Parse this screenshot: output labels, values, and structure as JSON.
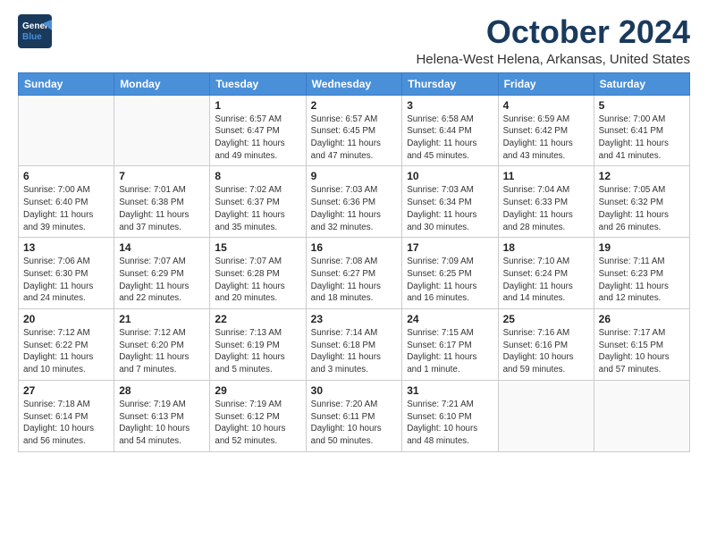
{
  "header": {
    "logo_line1": "General",
    "logo_line2": "Blue",
    "month": "October 2024",
    "location": "Helena-West Helena, Arkansas, United States"
  },
  "weekdays": [
    "Sunday",
    "Monday",
    "Tuesday",
    "Wednesday",
    "Thursday",
    "Friday",
    "Saturday"
  ],
  "weeks": [
    [
      {
        "day": "",
        "info": ""
      },
      {
        "day": "",
        "info": ""
      },
      {
        "day": "1",
        "info": "Sunrise: 6:57 AM\nSunset: 6:47 PM\nDaylight: 11 hours and 49 minutes."
      },
      {
        "day": "2",
        "info": "Sunrise: 6:57 AM\nSunset: 6:45 PM\nDaylight: 11 hours and 47 minutes."
      },
      {
        "day": "3",
        "info": "Sunrise: 6:58 AM\nSunset: 6:44 PM\nDaylight: 11 hours and 45 minutes."
      },
      {
        "day": "4",
        "info": "Sunrise: 6:59 AM\nSunset: 6:42 PM\nDaylight: 11 hours and 43 minutes."
      },
      {
        "day": "5",
        "info": "Sunrise: 7:00 AM\nSunset: 6:41 PM\nDaylight: 11 hours and 41 minutes."
      }
    ],
    [
      {
        "day": "6",
        "info": "Sunrise: 7:00 AM\nSunset: 6:40 PM\nDaylight: 11 hours and 39 minutes."
      },
      {
        "day": "7",
        "info": "Sunrise: 7:01 AM\nSunset: 6:38 PM\nDaylight: 11 hours and 37 minutes."
      },
      {
        "day": "8",
        "info": "Sunrise: 7:02 AM\nSunset: 6:37 PM\nDaylight: 11 hours and 35 minutes."
      },
      {
        "day": "9",
        "info": "Sunrise: 7:03 AM\nSunset: 6:36 PM\nDaylight: 11 hours and 32 minutes."
      },
      {
        "day": "10",
        "info": "Sunrise: 7:03 AM\nSunset: 6:34 PM\nDaylight: 11 hours and 30 minutes."
      },
      {
        "day": "11",
        "info": "Sunrise: 7:04 AM\nSunset: 6:33 PM\nDaylight: 11 hours and 28 minutes."
      },
      {
        "day": "12",
        "info": "Sunrise: 7:05 AM\nSunset: 6:32 PM\nDaylight: 11 hours and 26 minutes."
      }
    ],
    [
      {
        "day": "13",
        "info": "Sunrise: 7:06 AM\nSunset: 6:30 PM\nDaylight: 11 hours and 24 minutes."
      },
      {
        "day": "14",
        "info": "Sunrise: 7:07 AM\nSunset: 6:29 PM\nDaylight: 11 hours and 22 minutes."
      },
      {
        "day": "15",
        "info": "Sunrise: 7:07 AM\nSunset: 6:28 PM\nDaylight: 11 hours and 20 minutes."
      },
      {
        "day": "16",
        "info": "Sunrise: 7:08 AM\nSunset: 6:27 PM\nDaylight: 11 hours and 18 minutes."
      },
      {
        "day": "17",
        "info": "Sunrise: 7:09 AM\nSunset: 6:25 PM\nDaylight: 11 hours and 16 minutes."
      },
      {
        "day": "18",
        "info": "Sunrise: 7:10 AM\nSunset: 6:24 PM\nDaylight: 11 hours and 14 minutes."
      },
      {
        "day": "19",
        "info": "Sunrise: 7:11 AM\nSunset: 6:23 PM\nDaylight: 11 hours and 12 minutes."
      }
    ],
    [
      {
        "day": "20",
        "info": "Sunrise: 7:12 AM\nSunset: 6:22 PM\nDaylight: 11 hours and 10 minutes."
      },
      {
        "day": "21",
        "info": "Sunrise: 7:12 AM\nSunset: 6:20 PM\nDaylight: 11 hours and 7 minutes."
      },
      {
        "day": "22",
        "info": "Sunrise: 7:13 AM\nSunset: 6:19 PM\nDaylight: 11 hours and 5 minutes."
      },
      {
        "day": "23",
        "info": "Sunrise: 7:14 AM\nSunset: 6:18 PM\nDaylight: 11 hours and 3 minutes."
      },
      {
        "day": "24",
        "info": "Sunrise: 7:15 AM\nSunset: 6:17 PM\nDaylight: 11 hours and 1 minute."
      },
      {
        "day": "25",
        "info": "Sunrise: 7:16 AM\nSunset: 6:16 PM\nDaylight: 10 hours and 59 minutes."
      },
      {
        "day": "26",
        "info": "Sunrise: 7:17 AM\nSunset: 6:15 PM\nDaylight: 10 hours and 57 minutes."
      }
    ],
    [
      {
        "day": "27",
        "info": "Sunrise: 7:18 AM\nSunset: 6:14 PM\nDaylight: 10 hours and 56 minutes."
      },
      {
        "day": "28",
        "info": "Sunrise: 7:19 AM\nSunset: 6:13 PM\nDaylight: 10 hours and 54 minutes."
      },
      {
        "day": "29",
        "info": "Sunrise: 7:19 AM\nSunset: 6:12 PM\nDaylight: 10 hours and 52 minutes."
      },
      {
        "day": "30",
        "info": "Sunrise: 7:20 AM\nSunset: 6:11 PM\nDaylight: 10 hours and 50 minutes."
      },
      {
        "day": "31",
        "info": "Sunrise: 7:21 AM\nSunset: 6:10 PM\nDaylight: 10 hours and 48 minutes."
      },
      {
        "day": "",
        "info": ""
      },
      {
        "day": "",
        "info": ""
      }
    ]
  ]
}
